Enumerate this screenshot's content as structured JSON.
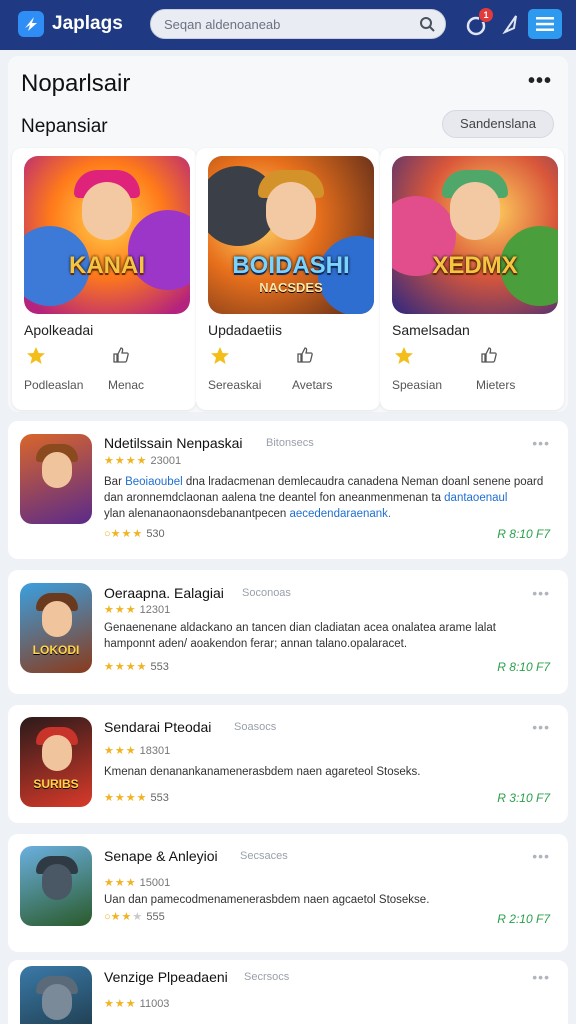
{
  "header": {
    "app_name": "Japlags",
    "search_placeholder": "Seqan aldenoaneab",
    "notification_count": "1",
    "colors": {
      "bar": "#1f3a82",
      "accent": "#2d9af0"
    }
  },
  "featured": {
    "title": "Noparlsair",
    "section_label": "Nepansiar",
    "button_label": "Sandenslana",
    "more_label": "•••",
    "cards": [
      {
        "art_title": "KANAI",
        "art_subtitle": "",
        "name": "Apolkeadai",
        "label1": "Podleaslan",
        "label2": "Menac",
        "icons": [
          "star-icon",
          "thumbs-up-icon"
        ]
      },
      {
        "art_title": "BOIDASHI",
        "art_subtitle": "NACSDES",
        "name": "Updadaetiis",
        "label1": "Sereaskai",
        "label2": "Avetars",
        "icons": [
          "star-icon",
          "thumbs-up-icon"
        ]
      },
      {
        "art_title": "XEDMX",
        "art_subtitle": "",
        "name": "Samelsadan",
        "label1": "Speasian",
        "label2": "Mieters",
        "icons": [
          "star-icon",
          "thumbs-up-icon"
        ]
      }
    ]
  },
  "list": [
    {
      "title": "Ndetilssain Nenpaskai",
      "tag": "Bitonsecs",
      "rating_stars": "★★★★",
      "rating_text": "23001",
      "desc1": "Bar ",
      "desc1_link": "Beoiaoubel",
      "desc1_rest": " dna lradacmenan demlecaudra canadena Neman doanl senene poard",
      "desc2": "dan aronnemdclaonan aalena tne deantel fon aneanmenmenan ta ",
      "desc2_link": "dantaoenaul",
      "desc3": "ylan alenanaonaonsdebanantpecen ",
      "desc3_link": "aecedendaraenank.",
      "foot_stars": "★★★",
      "foot_text": "530",
      "price": "R 8:10 F7",
      "thumb_text": "",
      "icons": [
        "refresh-icon"
      ]
    },
    {
      "title": "Oeraapna. Ealagiai",
      "tag": "Soconoas",
      "rating_stars": "★★★",
      "rating_text": "12301",
      "desc1": "Genaenenane aldackano an tancen dian cladiatan acea onalatea arame lalat",
      "desc2": "hamponnt aden/ aoakendon ferar; annan talano.opalaracet.",
      "foot_stars": "★★★★",
      "foot_text": "553",
      "price": "R 8:10 F7",
      "thumb_text": "LOKODI"
    },
    {
      "title": "Sendarai Pteodai",
      "tag": "Soasocs",
      "rating_stars": "★★★",
      "rating_text": "18301",
      "desc1": "Kmenan denanankanamenerasbdem naen agareteol Stoseks.",
      "foot_stars": "★★★★",
      "foot_text": "553",
      "price": "R 3:10 F7",
      "thumb_text": "SURIBS"
    },
    {
      "title": "Senape & Anleyioi",
      "tag": "Secsaces",
      "rating_stars": "★★★",
      "rating_text": "15001",
      "desc1": "Uan dan pamecodmenamenerasbdem naen agcaetol Stosekse.",
      "foot_stars": "★★",
      "foot_stars_grey": "★",
      "foot_text": "555",
      "price": "R 2:10 F7",
      "thumb_text": "",
      "icons": [
        "refresh-icon"
      ]
    },
    {
      "title": "Venzige Plpeadaeni",
      "tag": "Secrsocs",
      "rating_stars": "★★★",
      "rating_text": "11003",
      "thumb_text": ""
    }
  ]
}
